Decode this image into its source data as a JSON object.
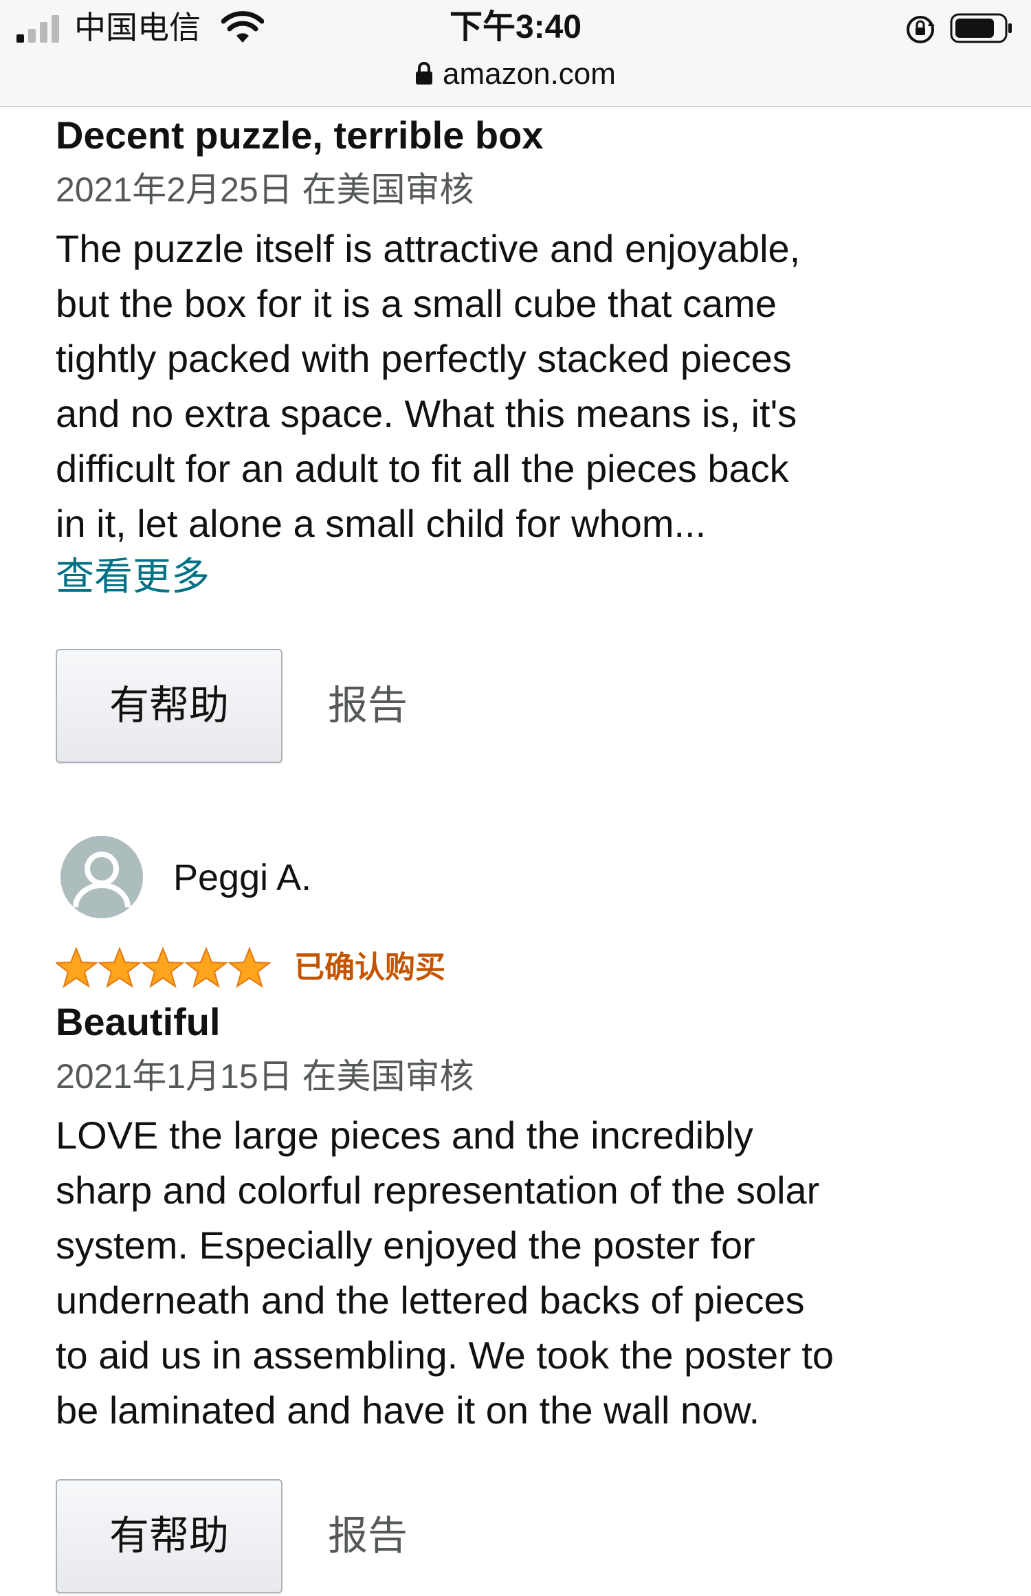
{
  "status_bar": {
    "carrier": "中国电信",
    "time": "下午3:40",
    "url": "amazon.com"
  },
  "reviews": [
    {
      "title": "Decent puzzle, terrible box",
      "date": "2021年2月25日 在美国审核",
      "body_lines": [
        "The puzzle itself is attractive and enjoyable,",
        "but the box for it is a small cube that came",
        "tightly packed with perfectly stacked pieces",
        "and no extra space. What this means is, it's",
        "difficult for an adult to fit all the pieces back",
        "in it, let alone a small child for whom..."
      ],
      "see_more": "查看更多",
      "helpful_label": "有帮助",
      "report_label": "报告"
    },
    {
      "reviewer": "Peggi A.",
      "rating": 5,
      "verified": "已确认购买",
      "title": "Beautiful",
      "date": "2021年1月15日 在美国审核",
      "body_lines": [
        "LOVE the large pieces and the incredibly",
        "sharp and colorful representation of the solar",
        "system. Especially enjoyed the poster for",
        "underneath and the lettered backs of pieces",
        "to aid us in assembling. We took the poster to",
        "be laminated and have it on the wall now."
      ],
      "helpful_label": "有帮助",
      "report_label": "报告"
    }
  ],
  "colors": {
    "link": "#007185",
    "star": "#ffa41c",
    "verified": "#c45500",
    "meta_text": "#565959"
  },
  "icons": {
    "signal": "cellular-signal-icon",
    "wifi": "wifi-icon",
    "rotation_lock": "rotation-lock-icon",
    "battery": "battery-icon",
    "lock": "lock-icon",
    "avatar": "default-avatar-icon",
    "star": "star-icon"
  }
}
